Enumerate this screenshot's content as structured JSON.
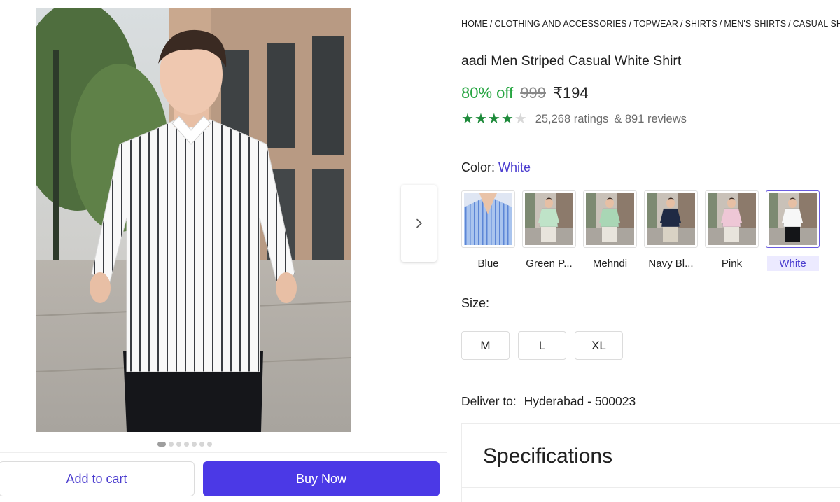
{
  "colors": {
    "brand": "#4b39e6",
    "brand_text": "#4a3ccf",
    "discount_green": "#26a541",
    "star_green": "#1d8a3a"
  },
  "gallery": {
    "image": "model-in-white-striped-shirt",
    "dot_count": 7,
    "active_dot": 0,
    "next_icon": "chevron-right-icon"
  },
  "actions": {
    "add_to_cart": "Add to cart",
    "buy_now": "Buy Now"
  },
  "breadcrumb": [
    "HOME",
    "CLOTHING AND ACCESSORIES",
    "TOPWEAR",
    "SHIRTS",
    "MEN'S SHIRTS",
    "CASUAL SH"
  ],
  "product": {
    "title": "aadi Men Striped Casual White Shirt",
    "discount": "80% off",
    "mrp": "999",
    "price": "₹194",
    "rating_stars": 4,
    "ratings": "25,268 ratings",
    "reviews": "& 891 reviews"
  },
  "color": {
    "label": "Color:",
    "selected": "White",
    "options": [
      {
        "label": "Blue",
        "shirt": "#8fb3e8"
      },
      {
        "label": "Green P...",
        "shirt": "#bfe3c8"
      },
      {
        "label": "Mehndi",
        "shirt": "#a9d6b5"
      },
      {
        "label": "Navy Bl...",
        "shirt": "#1f2a44"
      },
      {
        "label": "Pink",
        "shirt": "#eec7d6"
      },
      {
        "label": "White",
        "shirt": "#f7f7f7"
      }
    ]
  },
  "size": {
    "label": "Size:",
    "options": [
      "M",
      "L",
      "XL"
    ]
  },
  "delivery": {
    "label": "Deliver to:",
    "location": "Hyderabad - 500023"
  },
  "specifications": {
    "title": "Specifications"
  }
}
